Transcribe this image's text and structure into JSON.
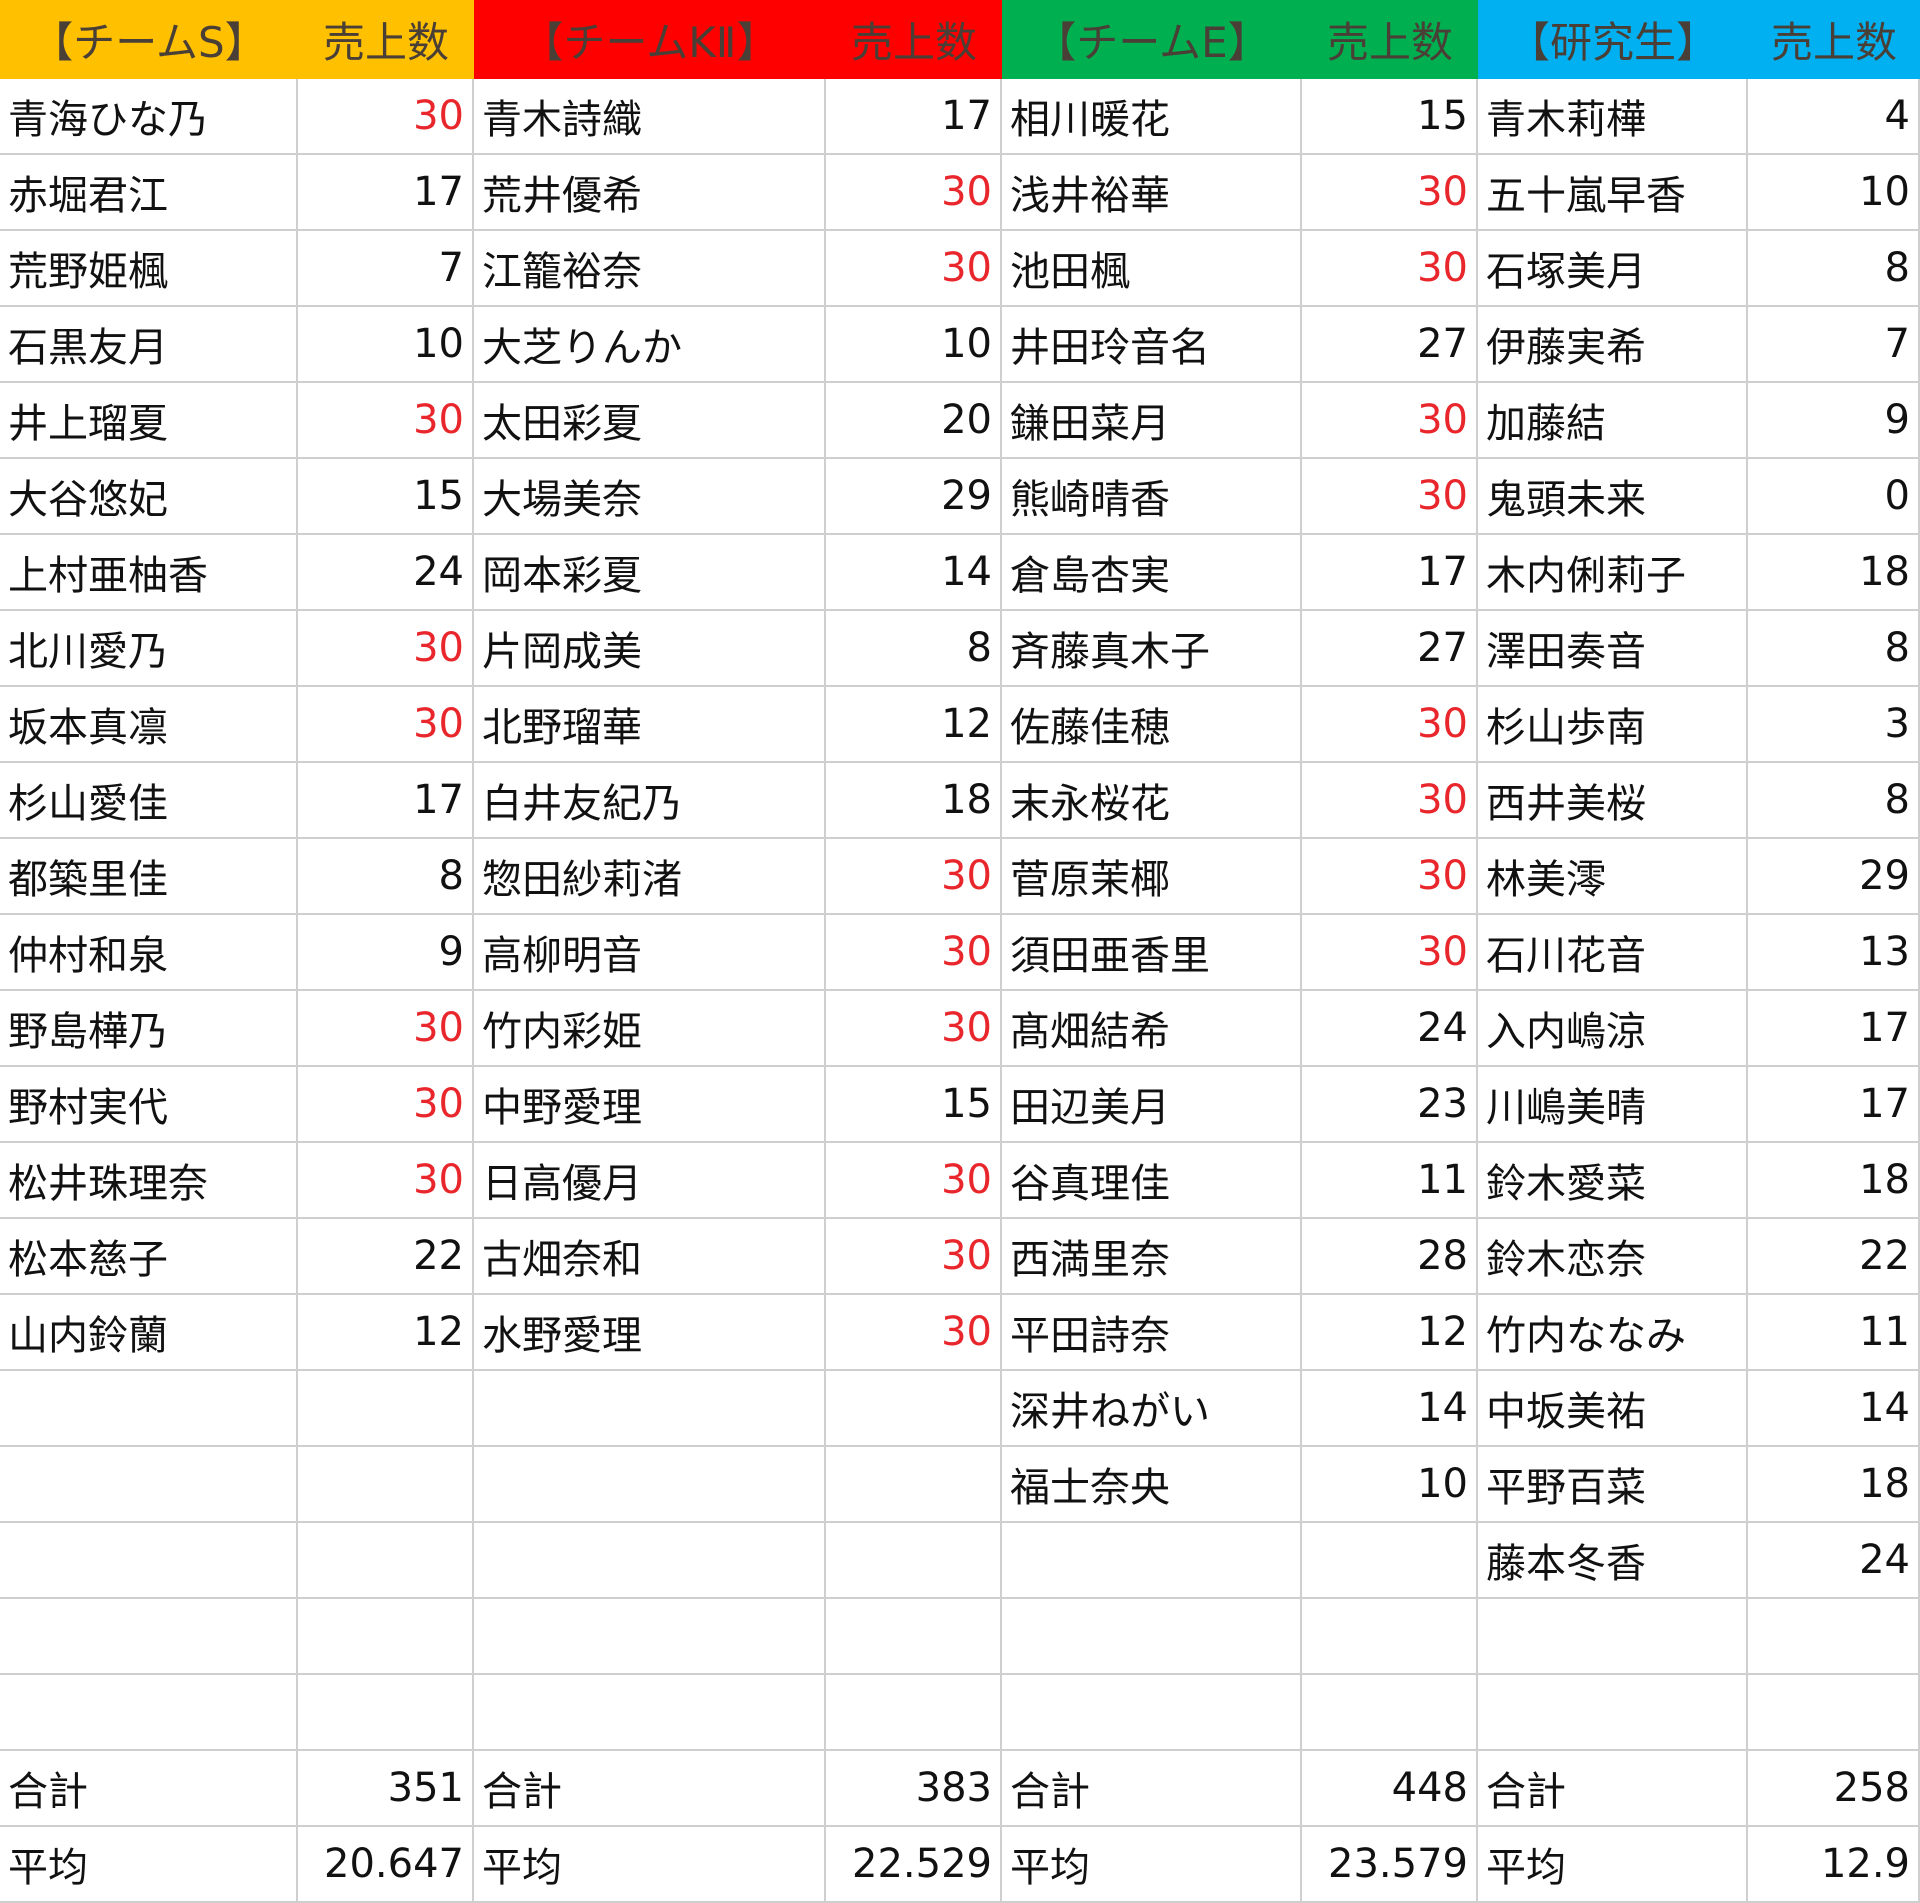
{
  "teams": [
    {
      "key": "team-s",
      "name": "【チームS】",
      "sales_header": "売上数",
      "members": [
        {
          "name": "青海ひな乃",
          "sales": "30"
        },
        {
          "name": "赤堀君江",
          "sales": "17"
        },
        {
          "name": "荒野姫楓",
          "sales": "7"
        },
        {
          "name": "石黒友月",
          "sales": "10"
        },
        {
          "name": "井上瑠夏",
          "sales": "30"
        },
        {
          "name": "大谷悠妃",
          "sales": "15"
        },
        {
          "name": "上村亜柚香",
          "sales": "24"
        },
        {
          "name": "北川愛乃",
          "sales": "30"
        },
        {
          "name": "坂本真凛",
          "sales": "30"
        },
        {
          "name": "杉山愛佳",
          "sales": "17"
        },
        {
          "name": "都築里佳",
          "sales": "8"
        },
        {
          "name": "仲村和泉",
          "sales": "9"
        },
        {
          "name": "野島樺乃",
          "sales": "30"
        },
        {
          "name": "野村実代",
          "sales": "30"
        },
        {
          "name": "松井珠理奈",
          "sales": "30"
        },
        {
          "name": "松本慈子",
          "sales": "22"
        },
        {
          "name": "山内鈴蘭",
          "sales": "12"
        }
      ],
      "total_label": "合計",
      "total": "351",
      "avg_label": "平均",
      "avg": "20.647"
    },
    {
      "key": "team-k",
      "name": "【チームKⅡ】",
      "sales_header": "売上数",
      "members": [
        {
          "name": "青木詩織",
          "sales": "17"
        },
        {
          "name": "荒井優希",
          "sales": "30"
        },
        {
          "name": "江籠裕奈",
          "sales": "30"
        },
        {
          "name": "大芝りんか",
          "sales": "10"
        },
        {
          "name": "太田彩夏",
          "sales": "20"
        },
        {
          "name": "大場美奈",
          "sales": "29"
        },
        {
          "name": "岡本彩夏",
          "sales": "14"
        },
        {
          "name": "片岡成美",
          "sales": "8"
        },
        {
          "name": "北野瑠華",
          "sales": "12"
        },
        {
          "name": "白井友紀乃",
          "sales": "18"
        },
        {
          "name": "惣田紗莉渚",
          "sales": "30"
        },
        {
          "name": "高柳明音",
          "sales": "30"
        },
        {
          "name": "竹内彩姫",
          "sales": "30"
        },
        {
          "name": "中野愛理",
          "sales": "15"
        },
        {
          "name": "日高優月",
          "sales": "30"
        },
        {
          "name": "古畑奈和",
          "sales": "30"
        },
        {
          "name": "水野愛理",
          "sales": "30"
        }
      ],
      "total_label": "合計",
      "total": "383",
      "avg_label": "平均",
      "avg": "22.529"
    },
    {
      "key": "team-e",
      "name": "【チームE】",
      "sales_header": "売上数",
      "members": [
        {
          "name": "相川暖花",
          "sales": "15"
        },
        {
          "name": "浅井裕華",
          "sales": "30"
        },
        {
          "name": "池田楓",
          "sales": "30"
        },
        {
          "name": "井田玲音名",
          "sales": "27"
        },
        {
          "name": "鎌田菜月",
          "sales": "30"
        },
        {
          "name": "熊崎晴香",
          "sales": "30"
        },
        {
          "name": "倉島杏実",
          "sales": "17"
        },
        {
          "name": "斉藤真木子",
          "sales": "27"
        },
        {
          "name": "佐藤佳穂",
          "sales": "30"
        },
        {
          "name": "末永桜花",
          "sales": "30"
        },
        {
          "name": "菅原茉椰",
          "sales": "30"
        },
        {
          "name": "須田亜香里",
          "sales": "30"
        },
        {
          "name": "髙畑結希",
          "sales": "24"
        },
        {
          "name": "田辺美月",
          "sales": "23"
        },
        {
          "name": "谷真理佳",
          "sales": "11"
        },
        {
          "name": "西満里奈",
          "sales": "28"
        },
        {
          "name": "平田詩奈",
          "sales": "12"
        },
        {
          "name": "深井ねがい",
          "sales": "14"
        },
        {
          "name": "福士奈央",
          "sales": "10"
        }
      ],
      "total_label": "合計",
      "total": "448",
      "avg_label": "平均",
      "avg": "23.579"
    },
    {
      "key": "team-k2",
      "name": "【研究生】",
      "sales_header": "売上数",
      "members": [
        {
          "name": "青木莉樺",
          "sales": "4"
        },
        {
          "name": "五十嵐早香",
          "sales": "10"
        },
        {
          "name": "石塚美月",
          "sales": "8"
        },
        {
          "name": "伊藤実希",
          "sales": "7"
        },
        {
          "name": "加藤結",
          "sales": "9"
        },
        {
          "name": "鬼頭未来",
          "sales": "0"
        },
        {
          "name": "木内俐莉子",
          "sales": "18"
        },
        {
          "name": "澤田奏音",
          "sales": "8"
        },
        {
          "name": "杉山歩南",
          "sales": "3"
        },
        {
          "name": "西井美桜",
          "sales": "8"
        },
        {
          "name": "林美澪",
          "sales": "29"
        },
        {
          "name": "石川花音",
          "sales": "13"
        },
        {
          "name": "入内嶋涼",
          "sales": "17"
        },
        {
          "name": "川嶋美晴",
          "sales": "17"
        },
        {
          "name": "鈴木愛菜",
          "sales": "18"
        },
        {
          "name": "鈴木恋奈",
          "sales": "22"
        },
        {
          "name": "竹内ななみ",
          "sales": "11"
        },
        {
          "name": "中坂美祐",
          "sales": "14"
        },
        {
          "name": "平野百菜",
          "sales": "18"
        },
        {
          "name": "藤本冬香",
          "sales": "24"
        }
      ],
      "total_label": "合計",
      "total": "258",
      "avg_label": "平均",
      "avg": "12.9"
    }
  ],
  "colors": {
    "team-s": "#ffc000",
    "team-k": "#ff0000",
    "team-e": "#00b050",
    "team-k2": "#00b0f0",
    "highlight_value": "#e8262b"
  },
  "highlight_sales_value": "30"
}
